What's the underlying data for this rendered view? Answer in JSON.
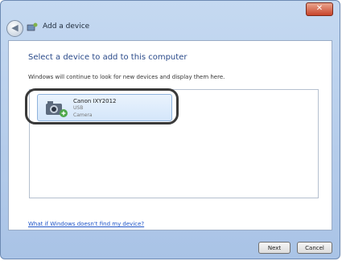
{
  "window": {
    "title": "Add a device",
    "close_label": "✕",
    "back_label": "◀"
  },
  "page": {
    "heading": "Select a device to add to this computer",
    "subtext": "Windows will continue to look for new devices and display them here."
  },
  "devices": [
    {
      "name": "Canon IXY2012",
      "model": "USB",
      "type": "Camera",
      "selected": true,
      "icon": "camera-icon"
    }
  ],
  "help_link": "What if Windows doesn't find my device?",
  "buttons": {
    "next": "Next",
    "cancel": "Cancel"
  }
}
